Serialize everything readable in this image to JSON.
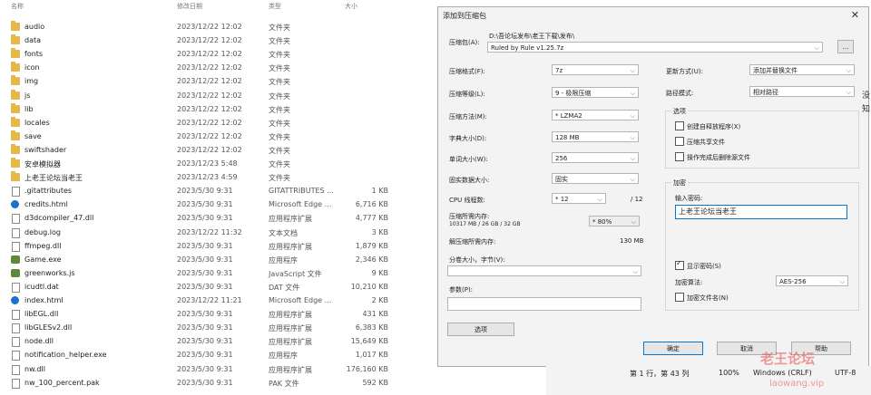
{
  "explorer": {
    "headers": {
      "name": "名称",
      "date": "修改日期",
      "type": "类型",
      "size": "大小"
    },
    "rows": [
      {
        "name": "audio",
        "date": "2023/12/22 12:02",
        "type": "文件夹",
        "size": "",
        "icon": "folder-icon"
      },
      {
        "name": "data",
        "date": "2023/12/22 12:02",
        "type": "文件夹",
        "size": "",
        "icon": "folder-icon"
      },
      {
        "name": "fonts",
        "date": "2023/12/22 12:02",
        "type": "文件夹",
        "size": "",
        "icon": "folder-icon"
      },
      {
        "name": "icon",
        "date": "2023/12/22 12:02",
        "type": "文件夹",
        "size": "",
        "icon": "folder-icon"
      },
      {
        "name": "img",
        "date": "2023/12/22 12:02",
        "type": "文件夹",
        "size": "",
        "icon": "folder-icon"
      },
      {
        "name": "js",
        "date": "2023/12/22 12:02",
        "type": "文件夹",
        "size": "",
        "icon": "folder-icon"
      },
      {
        "name": "lib",
        "date": "2023/12/22 12:02",
        "type": "文件夹",
        "size": "",
        "icon": "folder-icon"
      },
      {
        "name": "locales",
        "date": "2023/12/22 12:02",
        "type": "文件夹",
        "size": "",
        "icon": "folder-icon"
      },
      {
        "name": "save",
        "date": "2023/12/22 12:02",
        "type": "文件夹",
        "size": "",
        "icon": "folder-icon"
      },
      {
        "name": "swiftshader",
        "date": "2023/12/22 12:02",
        "type": "文件夹",
        "size": "",
        "icon": "folder-icon"
      },
      {
        "name": "安卓模拟器",
        "date": "2023/12/23 5:48",
        "type": "文件夹",
        "size": "",
        "icon": "folder-icon"
      },
      {
        "name": "上老王论坛当老王",
        "date": "2023/12/23 4:59",
        "type": "文件夹",
        "size": "",
        "icon": "folder-icon"
      },
      {
        "name": ".gitattributes",
        "date": "2023/5/30 9:31",
        "type": "GITATTRIBUTES ...",
        "size": "1 KB",
        "icon": "file-icon"
      },
      {
        "name": "credits.html",
        "date": "2023/5/30 9:31",
        "type": "Microsoft Edge ...",
        "size": "6,716 KB",
        "icon": "edge-icon"
      },
      {
        "name": "d3dcompiler_47.dll",
        "date": "2023/5/30 9:31",
        "type": "应用程序扩展",
        "size": "4,777 KB",
        "icon": "file-icon"
      },
      {
        "name": "debug.log",
        "date": "2023/12/22 11:32",
        "type": "文本文档",
        "size": "3 KB",
        "icon": "file-icon"
      },
      {
        "name": "ffmpeg.dll",
        "date": "2023/5/30 9:31",
        "type": "应用程序扩展",
        "size": "1,879 KB",
        "icon": "file-icon"
      },
      {
        "name": "Game.exe",
        "date": "2023/5/30 9:31",
        "type": "应用程序",
        "size": "2,346 KB",
        "icon": "app-icon"
      },
      {
        "name": "greenworks.js",
        "date": "2023/5/30 9:31",
        "type": "JavaScript 文件",
        "size": "9 KB",
        "icon": "app-icon"
      },
      {
        "name": "icudtl.dat",
        "date": "2023/5/30 9:31",
        "type": "DAT 文件",
        "size": "10,210 KB",
        "icon": "file-icon"
      },
      {
        "name": "index.html",
        "date": "2023/12/22 11:21",
        "type": "Microsoft Edge ...",
        "size": "2 KB",
        "icon": "edge-icon"
      },
      {
        "name": "libEGL.dll",
        "date": "2023/5/30 9:31",
        "type": "应用程序扩展",
        "size": "431 KB",
        "icon": "file-icon"
      },
      {
        "name": "libGLESv2.dll",
        "date": "2023/5/30 9:31",
        "type": "应用程序扩展",
        "size": "6,383 KB",
        "icon": "file-icon"
      },
      {
        "name": "node.dll",
        "date": "2023/5/30 9:31",
        "type": "应用程序扩展",
        "size": "15,649 KB",
        "icon": "file-icon"
      },
      {
        "name": "notification_helper.exe",
        "date": "2023/5/30 9:31",
        "type": "应用程序",
        "size": "1,017 KB",
        "icon": "file-icon"
      },
      {
        "name": "nw.dll",
        "date": "2023/5/30 9:31",
        "type": "应用程序扩展",
        "size": "176,160 KB",
        "icon": "file-icon"
      },
      {
        "name": "nw_100_percent.pak",
        "date": "2023/5/30 9:31",
        "type": "PAK 文件",
        "size": "592 KB",
        "icon": "file-icon"
      }
    ]
  },
  "dialog": {
    "title": "添加到压缩包",
    "close": "✕",
    "archive_label": "压缩包(A):",
    "archive_path": "D:\\吾论坛发布\\老王下载\\发布\\",
    "archive_name": "Ruled by Rule v1.25.7z",
    "browse": "...",
    "format_label": "压缩格式(F):",
    "format_value": "7z",
    "level_label": "压缩等级(L):",
    "level_value": "9 - 极限压缩",
    "method_label": "压缩方法(M):",
    "method_value": "* LZMA2",
    "dict_label": "字典大小(D):",
    "dict_value": "128 MB",
    "word_label": "单词大小(W):",
    "word_value": "256",
    "solid_label": "固实数据大小:",
    "solid_value": "固实",
    "threads_label": "CPU 线程数:",
    "threads_value": "* 12",
    "threads_total": "/ 12",
    "mem_label": "压缩所需内存:",
    "mem_sub": "10317 MB / 26 GB / 32 GB",
    "mem_value": "* 80%",
    "decomp_label": "解压缩所需内存:",
    "decomp_value": "130 MB",
    "split_label": "分卷大小，字节(V):",
    "params_label": "参数(P):",
    "options_button": "选项",
    "update_label": "更新方式(U):",
    "update_value": "添加并替换文件",
    "path_label": "路径模式:",
    "path_value": "相对路径",
    "options_group": "选项",
    "opt_sfx": "创建自释放程序(X)",
    "opt_shared": "压缩共享文件",
    "opt_delete": "操作完成后删除源文件",
    "enc_group": "加密",
    "pwd_label": "输入密码:",
    "pwd_value": "上老王论坛当老王",
    "show_pwd": "显示密码(S)",
    "enc_method_label": "加密算法:",
    "enc_method_value": "AES-256",
    "enc_names": "加密文件名(N)",
    "ok": "确定",
    "cancel": "取消",
    "help": "帮助"
  },
  "statusbar": {
    "pos": "第 1 行，第 43 列",
    "zoom": "100%",
    "eol": "Windows (CRLF)",
    "enc": "UTF-8"
  },
  "edge_chars": [
    "没",
    "知"
  ],
  "watermark": {
    "text": "老王论坛",
    "url": "laowang.vip"
  }
}
